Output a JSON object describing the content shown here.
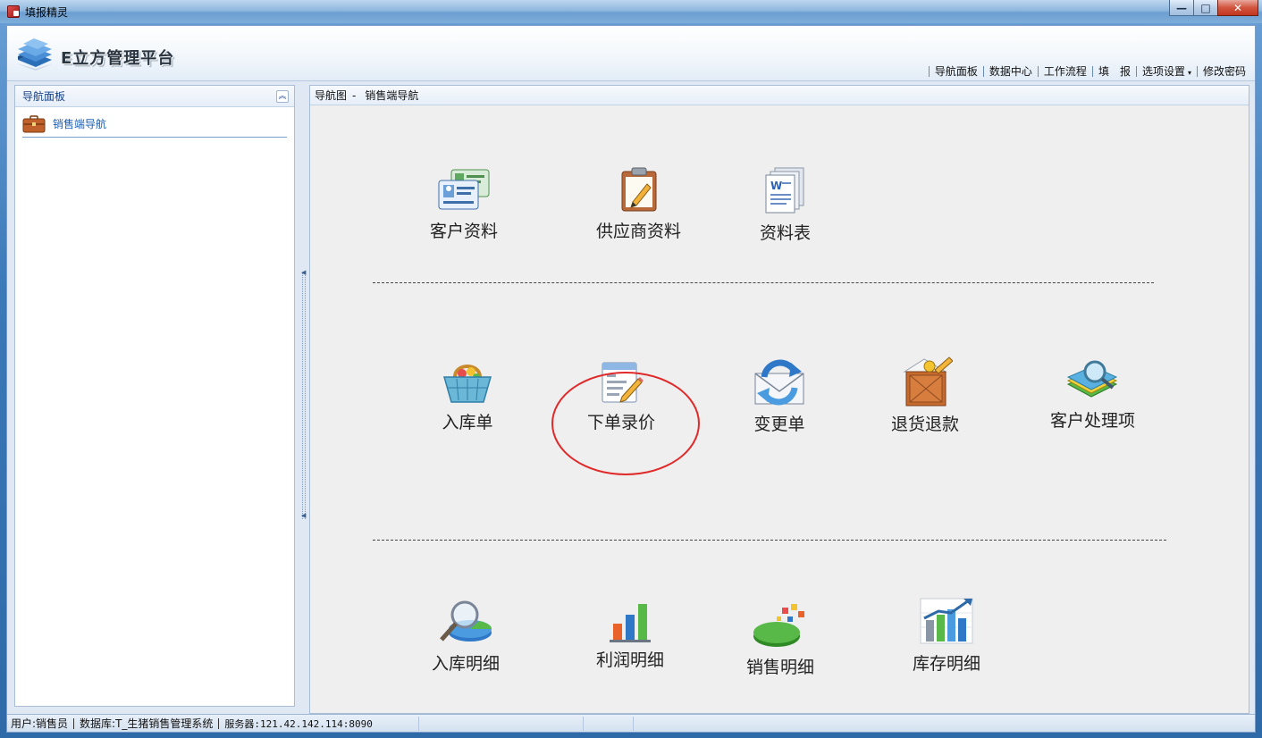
{
  "window": {
    "title": "填报精灵",
    "minimize": "—",
    "maximize": "□",
    "close": "✕"
  },
  "header": {
    "logo_text": "E立方管理平台",
    "nav": [
      {
        "label": "导航面板"
      },
      {
        "label": "数据中心"
      },
      {
        "label": "工作流程"
      },
      {
        "label": "填　报"
      },
      {
        "label": "选项设置",
        "caret": "▾"
      },
      {
        "label": "修改密码"
      }
    ]
  },
  "left_panel": {
    "title": "导航面板",
    "collapse_glyph": "︽",
    "items": [
      {
        "label": "销售端导航",
        "icon": "briefcase-icon"
      }
    ]
  },
  "main": {
    "breadcrumb_prefix": "导航图",
    "breadcrumb_sep": "-",
    "breadcrumb_current": "销售端导航",
    "tiles": {
      "customer_info": {
        "label": "客户资料",
        "icon": "customer-card-icon"
      },
      "supplier_info": {
        "label": "供应商资料",
        "icon": "clipboard-icon"
      },
      "data_sheet": {
        "label": "资料表",
        "icon": "word-document-icon"
      },
      "stock_in": {
        "label": "入库单",
        "icon": "shopping-basket-icon"
      },
      "order_pricing": {
        "label": "下单录价",
        "icon": "edit-form-icon",
        "highlighted": true
      },
      "change_order": {
        "label": "变更单",
        "icon": "mail-sync-icon"
      },
      "return_refund": {
        "label": "退货退款",
        "icon": "return-box-icon"
      },
      "customer_issues": {
        "label": "客户处理项",
        "icon": "book-search-icon"
      },
      "stock_in_detail": {
        "label": "入库明细",
        "icon": "magnifier-pie-icon"
      },
      "profit_detail": {
        "label": "利润明细",
        "icon": "bar-chart-icon"
      },
      "sales_detail": {
        "label": "销售明细",
        "icon": "pie-chart-icon"
      },
      "inventory_detail": {
        "label": "库存明细",
        "icon": "growth-chart-icon"
      }
    }
  },
  "status_bar": {
    "user": "用户:销售员",
    "database": "数据库:T_生猪销售管理系统",
    "server": "服务器:121.42.142.114:8090"
  },
  "colors": {
    "accent": "#15428b",
    "highlight_ring": "#e02a2a",
    "link": "#1a5fb4"
  }
}
